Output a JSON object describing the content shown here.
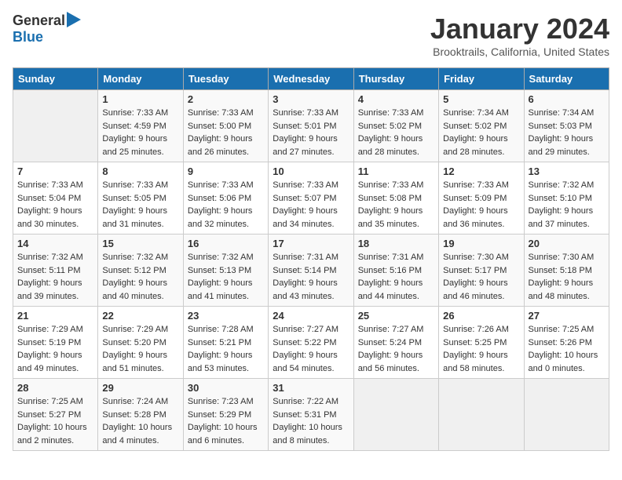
{
  "header": {
    "logo_general": "General",
    "logo_blue": "Blue",
    "month_title": "January 2024",
    "location": "Brooktrails, California, United States"
  },
  "days_of_week": [
    "Sunday",
    "Monday",
    "Tuesday",
    "Wednesday",
    "Thursday",
    "Friday",
    "Saturday"
  ],
  "weeks": [
    [
      {
        "day": "",
        "sunrise": "",
        "sunset": "",
        "daylight": ""
      },
      {
        "day": "1",
        "sunrise": "Sunrise: 7:33 AM",
        "sunset": "Sunset: 4:59 PM",
        "daylight": "Daylight: 9 hours and 25 minutes."
      },
      {
        "day": "2",
        "sunrise": "Sunrise: 7:33 AM",
        "sunset": "Sunset: 5:00 PM",
        "daylight": "Daylight: 9 hours and 26 minutes."
      },
      {
        "day": "3",
        "sunrise": "Sunrise: 7:33 AM",
        "sunset": "Sunset: 5:01 PM",
        "daylight": "Daylight: 9 hours and 27 minutes."
      },
      {
        "day": "4",
        "sunrise": "Sunrise: 7:33 AM",
        "sunset": "Sunset: 5:02 PM",
        "daylight": "Daylight: 9 hours and 28 minutes."
      },
      {
        "day": "5",
        "sunrise": "Sunrise: 7:34 AM",
        "sunset": "Sunset: 5:02 PM",
        "daylight": "Daylight: 9 hours and 28 minutes."
      },
      {
        "day": "6",
        "sunrise": "Sunrise: 7:34 AM",
        "sunset": "Sunset: 5:03 PM",
        "daylight": "Daylight: 9 hours and 29 minutes."
      }
    ],
    [
      {
        "day": "7",
        "sunrise": "Sunrise: 7:33 AM",
        "sunset": "Sunset: 5:04 PM",
        "daylight": "Daylight: 9 hours and 30 minutes."
      },
      {
        "day": "8",
        "sunrise": "Sunrise: 7:33 AM",
        "sunset": "Sunset: 5:05 PM",
        "daylight": "Daylight: 9 hours and 31 minutes."
      },
      {
        "day": "9",
        "sunrise": "Sunrise: 7:33 AM",
        "sunset": "Sunset: 5:06 PM",
        "daylight": "Daylight: 9 hours and 32 minutes."
      },
      {
        "day": "10",
        "sunrise": "Sunrise: 7:33 AM",
        "sunset": "Sunset: 5:07 PM",
        "daylight": "Daylight: 9 hours and 34 minutes."
      },
      {
        "day": "11",
        "sunrise": "Sunrise: 7:33 AM",
        "sunset": "Sunset: 5:08 PM",
        "daylight": "Daylight: 9 hours and 35 minutes."
      },
      {
        "day": "12",
        "sunrise": "Sunrise: 7:33 AM",
        "sunset": "Sunset: 5:09 PM",
        "daylight": "Daylight: 9 hours and 36 minutes."
      },
      {
        "day": "13",
        "sunrise": "Sunrise: 7:32 AM",
        "sunset": "Sunset: 5:10 PM",
        "daylight": "Daylight: 9 hours and 37 minutes."
      }
    ],
    [
      {
        "day": "14",
        "sunrise": "Sunrise: 7:32 AM",
        "sunset": "Sunset: 5:11 PM",
        "daylight": "Daylight: 9 hours and 39 minutes."
      },
      {
        "day": "15",
        "sunrise": "Sunrise: 7:32 AM",
        "sunset": "Sunset: 5:12 PM",
        "daylight": "Daylight: 9 hours and 40 minutes."
      },
      {
        "day": "16",
        "sunrise": "Sunrise: 7:32 AM",
        "sunset": "Sunset: 5:13 PM",
        "daylight": "Daylight: 9 hours and 41 minutes."
      },
      {
        "day": "17",
        "sunrise": "Sunrise: 7:31 AM",
        "sunset": "Sunset: 5:14 PM",
        "daylight": "Daylight: 9 hours and 43 minutes."
      },
      {
        "day": "18",
        "sunrise": "Sunrise: 7:31 AM",
        "sunset": "Sunset: 5:16 PM",
        "daylight": "Daylight: 9 hours and 44 minutes."
      },
      {
        "day": "19",
        "sunrise": "Sunrise: 7:30 AM",
        "sunset": "Sunset: 5:17 PM",
        "daylight": "Daylight: 9 hours and 46 minutes."
      },
      {
        "day": "20",
        "sunrise": "Sunrise: 7:30 AM",
        "sunset": "Sunset: 5:18 PM",
        "daylight": "Daylight: 9 hours and 48 minutes."
      }
    ],
    [
      {
        "day": "21",
        "sunrise": "Sunrise: 7:29 AM",
        "sunset": "Sunset: 5:19 PM",
        "daylight": "Daylight: 9 hours and 49 minutes."
      },
      {
        "day": "22",
        "sunrise": "Sunrise: 7:29 AM",
        "sunset": "Sunset: 5:20 PM",
        "daylight": "Daylight: 9 hours and 51 minutes."
      },
      {
        "day": "23",
        "sunrise": "Sunrise: 7:28 AM",
        "sunset": "Sunset: 5:21 PM",
        "daylight": "Daylight: 9 hours and 53 minutes."
      },
      {
        "day": "24",
        "sunrise": "Sunrise: 7:27 AM",
        "sunset": "Sunset: 5:22 PM",
        "daylight": "Daylight: 9 hours and 54 minutes."
      },
      {
        "day": "25",
        "sunrise": "Sunrise: 7:27 AM",
        "sunset": "Sunset: 5:24 PM",
        "daylight": "Daylight: 9 hours and 56 minutes."
      },
      {
        "day": "26",
        "sunrise": "Sunrise: 7:26 AM",
        "sunset": "Sunset: 5:25 PM",
        "daylight": "Daylight: 9 hours and 58 minutes."
      },
      {
        "day": "27",
        "sunrise": "Sunrise: 7:25 AM",
        "sunset": "Sunset: 5:26 PM",
        "daylight": "Daylight: 10 hours and 0 minutes."
      }
    ],
    [
      {
        "day": "28",
        "sunrise": "Sunrise: 7:25 AM",
        "sunset": "Sunset: 5:27 PM",
        "daylight": "Daylight: 10 hours and 2 minutes."
      },
      {
        "day": "29",
        "sunrise": "Sunrise: 7:24 AM",
        "sunset": "Sunset: 5:28 PM",
        "daylight": "Daylight: 10 hours and 4 minutes."
      },
      {
        "day": "30",
        "sunrise": "Sunrise: 7:23 AM",
        "sunset": "Sunset: 5:29 PM",
        "daylight": "Daylight: 10 hours and 6 minutes."
      },
      {
        "day": "31",
        "sunrise": "Sunrise: 7:22 AM",
        "sunset": "Sunset: 5:31 PM",
        "daylight": "Daylight: 10 hours and 8 minutes."
      },
      {
        "day": "",
        "sunrise": "",
        "sunset": "",
        "daylight": ""
      },
      {
        "day": "",
        "sunrise": "",
        "sunset": "",
        "daylight": ""
      },
      {
        "day": "",
        "sunrise": "",
        "sunset": "",
        "daylight": ""
      }
    ]
  ]
}
